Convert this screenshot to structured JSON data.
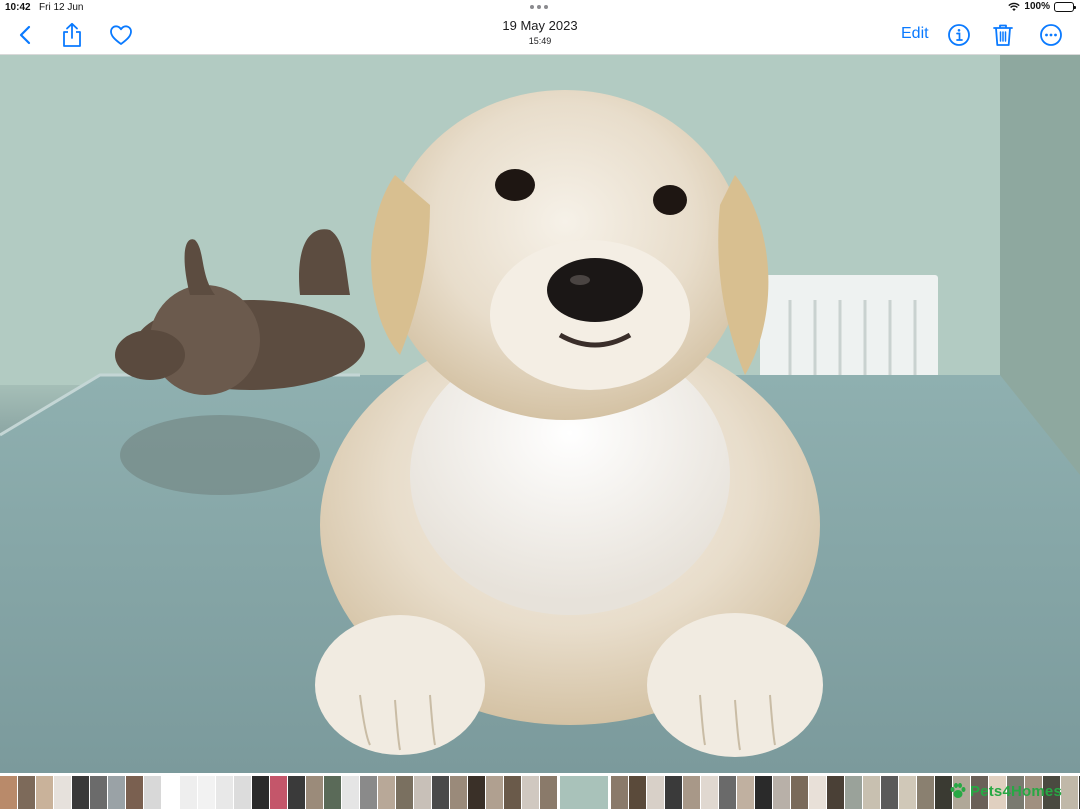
{
  "status_bar": {
    "time": "10:42",
    "date": "Fri 12 Jun",
    "battery_percent": "100%",
    "battery_level": 1.0
  },
  "toolbar": {
    "title_date": "19 May 2023",
    "title_time": "15:49",
    "edit_label": "Edit",
    "icons": [
      "chevron-left-icon",
      "share-icon",
      "heart-icon",
      "info-icon",
      "trash-icon",
      "more-icon"
    ],
    "accent_color": "#0a7aff"
  },
  "photo": {
    "subject": "golden retriever puppy",
    "watermark": "Pets4Homes",
    "watermark_color": "#27a844"
  },
  "filmstrip": {
    "thumbnail_colors_left": [
      "#b98a6a",
      "#7d6a5a",
      "#c9b29a",
      "#e6e1dc",
      "#3a3a3a",
      "#6b6b6b",
      "#9aa2a6",
      "#7a6050",
      "#d8d8d8",
      "#ffffff",
      "#eeeeee",
      "#f2f2f2",
      "#e8e8e8",
      "#dcdcdc",
      "#2b2b2b",
      "#c4566a",
      "#3a3a3a",
      "#9b8b7a",
      "#5a6a58",
      "#e5e5e5",
      "#8a8a8a",
      "#b8a898",
      "#7a7060",
      "#c8c0b8",
      "#4a4a4a",
      "#9a8a7a",
      "#3a3028",
      "#b0a090",
      "#6a5a4a",
      "#d0c8c0",
      "#8a7a6a"
    ],
    "current_color": "#a9c2ba",
    "thumbnail_colors_right": [
      "#8a7a6a",
      "#5a4a3a",
      "#d8d0c8",
      "#3a3a3a",
      "#a89888",
      "#e0d8d0",
      "#6a6a6a",
      "#c0b0a0",
      "#2a2a2a",
      "#b8b0a8",
      "#7a6a5a",
      "#e8e0d8",
      "#4a4036",
      "#9aa29a",
      "#c8c0b0",
      "#5a5a5a",
      "#d0c8b8",
      "#8a8070",
      "#3a3a32",
      "#b0a898",
      "#6a6058",
      "#e0d0c0",
      "#7a7a70",
      "#a09080",
      "#4a4a40",
      "#c0b8a8",
      "#2f2f2a",
      "#9a9080",
      "#5a5048",
      "#d8d0c0",
      "#7a6a60"
    ]
  }
}
